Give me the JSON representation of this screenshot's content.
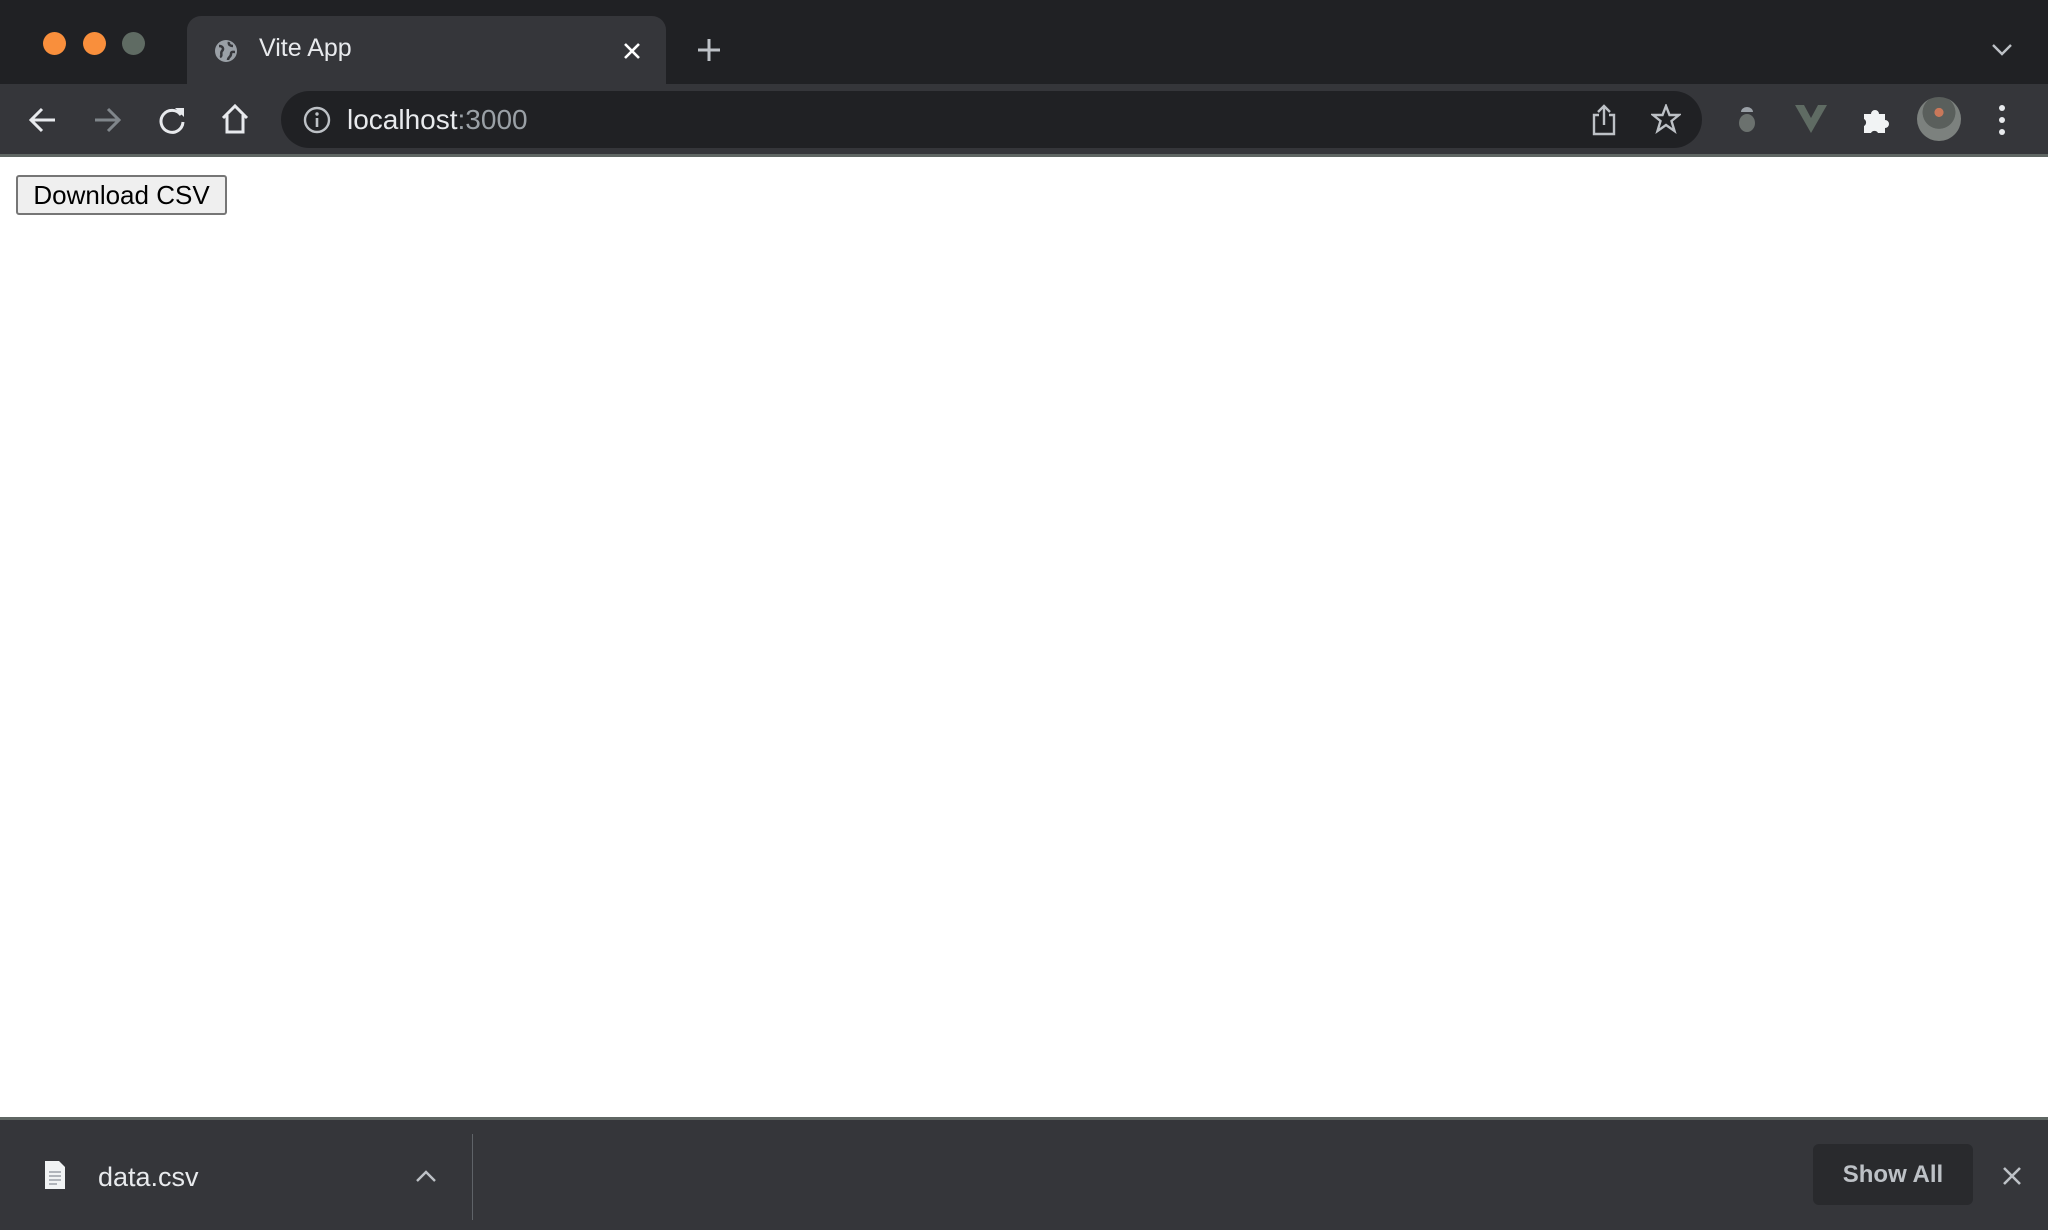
{
  "window": {
    "traffic_lights": [
      "#f98f3c",
      "#f98f3c",
      "#5f6b63"
    ]
  },
  "tab": {
    "title": "Vite App",
    "favicon": "globe-icon"
  },
  "toolbar": {
    "url_host": "localhost",
    "url_port": ":3000",
    "icons": [
      "back-arrow-icon",
      "forward-arrow-icon",
      "reload-icon",
      "home-icon",
      "info-icon",
      "share-icon",
      "star-icon",
      "bug-extension-icon",
      "vue-extension-icon",
      "puzzle-icon",
      "avatar",
      "more-vert-icon"
    ]
  },
  "page": {
    "download_button": "Download CSV"
  },
  "shelf": {
    "file_name": "data.csv",
    "show_all": "Show All"
  }
}
